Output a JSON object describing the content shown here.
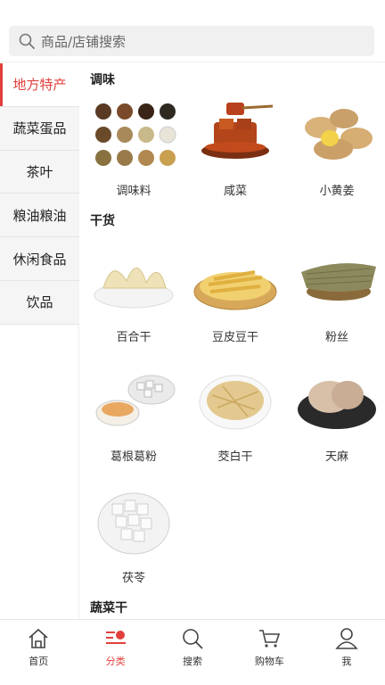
{
  "search": {
    "placeholder": "商品/店铺搜索"
  },
  "sidebar": {
    "items": [
      {
        "label": "地方特产",
        "active": true
      },
      {
        "label": "蔬菜蛋品",
        "active": false
      },
      {
        "label": "茶叶",
        "active": false
      },
      {
        "label": "粮油粮油",
        "active": false
      },
      {
        "label": "休闲食品",
        "active": false
      },
      {
        "label": "饮品",
        "active": false
      }
    ]
  },
  "sections": {
    "s1": {
      "title": "调味",
      "items": [
        {
          "name": "调味料"
        },
        {
          "name": "咸菜"
        },
        {
          "name": "小黄姜"
        }
      ]
    },
    "s2": {
      "title": "干货",
      "items": [
        {
          "name": "百合干"
        },
        {
          "name": "豆皮豆干"
        },
        {
          "name": "粉丝"
        },
        {
          "name": "葛根葛粉"
        },
        {
          "name": "茭白干"
        },
        {
          "name": "天麻"
        },
        {
          "name": "茯苓"
        }
      ]
    },
    "s3": {
      "title": "蔬菜干"
    }
  },
  "tabbar": {
    "items": [
      {
        "label": "首页",
        "icon": "home-icon"
      },
      {
        "label": "分类",
        "icon": "category-icon",
        "active": true
      },
      {
        "label": "搜索",
        "icon": "search-icon"
      },
      {
        "label": "购物车",
        "icon": "cart-icon"
      },
      {
        "label": "我",
        "icon": "user-icon"
      }
    ]
  },
  "colors": {
    "accent": "#e2403c",
    "sidebar_bg": "#f5f5f5",
    "search_bg": "#f0f0f0"
  }
}
